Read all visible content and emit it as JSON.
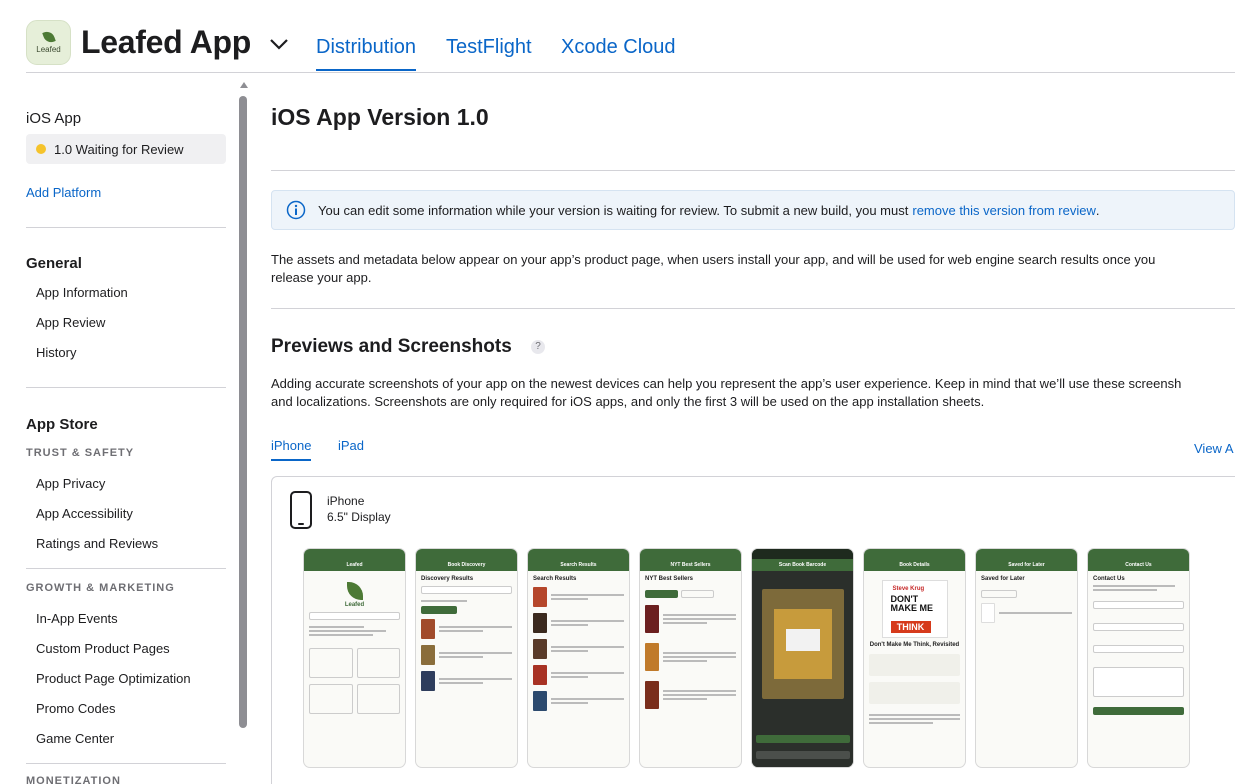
{
  "header": {
    "app_icon_text": "Leafed",
    "app_name": "Leafed App",
    "tabs": [
      {
        "label": "Distribution",
        "active": true
      },
      {
        "label": "TestFlight",
        "active": false
      },
      {
        "label": "Xcode Cloud",
        "active": false
      }
    ]
  },
  "sidebar": {
    "ios_app_heading": "iOS App",
    "version_status": "1.0 Waiting for Review",
    "add_platform": "Add Platform",
    "general_heading": "General",
    "general_items": [
      "App Information",
      "App Review",
      "History"
    ],
    "app_store_heading": "App Store",
    "trust_heading": "TRUST & SAFETY",
    "trust_items": [
      "App Privacy",
      "App Accessibility",
      "Ratings and Reviews"
    ],
    "growth_heading": "GROWTH & MARKETING",
    "growth_items": [
      "In-App Events",
      "Custom Product Pages",
      "Product Page Optimization",
      "Promo Codes",
      "Game Center"
    ],
    "monetization_heading": "MONETIZATION"
  },
  "main": {
    "title": "iOS App Version 1.0",
    "info_text": "You can edit some information while your version is waiting for review. To submit a new build, you must",
    "info_link": "remove this version from review",
    "info_suffix": ".",
    "assets_line1": "The assets and metadata below appear on your app’s product page, when users install your app, and will be used for web engine search results once you",
    "assets_line2": "release your app.",
    "previews_title": "Previews and Screenshots",
    "help_badge": "?",
    "previews_line1": "Adding accurate screenshots of your app on the newest devices can help you represent the app’s user experience. Keep in mind that we’ll use these screensh",
    "previews_line2": "and localizations. Screenshots are only required for iOS apps, and only the first 3 will be used on the app installation sheets.",
    "device_tabs": [
      {
        "label": "iPhone",
        "active": true
      },
      {
        "label": "iPad",
        "active": false
      }
    ],
    "view_all": "View A",
    "device_name": "iPhone",
    "device_size": "6.5\" Display",
    "screenshots": [
      {
        "title": "Leafed",
        "heading": "Leafed"
      },
      {
        "title": "Book Discovery",
        "heading": "Discovery Results"
      },
      {
        "title": "Search Results",
        "heading": "Search Results"
      },
      {
        "title": "NYT Best Sellers",
        "heading": "NYT Best Sellers"
      },
      {
        "title": "Scan Book Barcode",
        "heading": "Scan Book Barcode"
      },
      {
        "title": "Book Details",
        "heading": "Don't Make Me Think, Revisited"
      },
      {
        "title": "Saved for Later",
        "heading": "Saved for Later"
      },
      {
        "title": "Contact Us",
        "heading": "Contact Us"
      }
    ],
    "book_cover": {
      "author": "Steve Krug",
      "line1": "DON'T",
      "line2": "MAKE",
      "line3": "ME",
      "line4": "THINK"
    }
  },
  "colors": {
    "accent": "#0a66c8",
    "status_dot": "#f5c32b",
    "app_green": "#3f6b3a"
  }
}
